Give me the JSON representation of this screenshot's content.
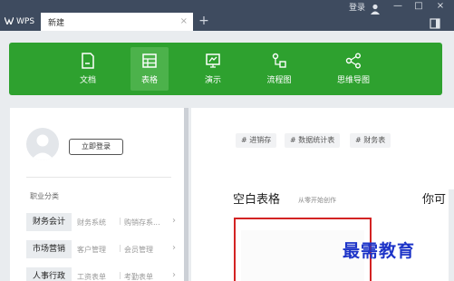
{
  "titlebar": {
    "logo_text": "WPS",
    "tab_label": "新建",
    "tab_close": "×",
    "new_tab": "+",
    "login_text": "登录",
    "win_minimize": "—",
    "win_maximize": "□",
    "win_close": "×"
  },
  "toolbar": {
    "items": [
      {
        "label": "文档",
        "icon": "document-icon"
      },
      {
        "label": "表格",
        "icon": "table-icon"
      },
      {
        "label": "演示",
        "icon": "presentation-icon"
      },
      {
        "label": "流程图",
        "icon": "flowchart-icon"
      },
      {
        "label": "思维导图",
        "icon": "mindmap-icon"
      }
    ],
    "active_index": 1,
    "colors": {
      "bg": "#2ea12f",
      "active": "#4cb24b"
    }
  },
  "left": {
    "login_button": "立即登录",
    "category_title": "职业分类",
    "categories": [
      {
        "main": "财务会计",
        "sub1": "财务系统",
        "sub2": "购销存系..."
      },
      {
        "main": "市场营销",
        "sub1": "客户管理",
        "sub2": "会员管理"
      },
      {
        "main": "人事行政",
        "sub1": "工资表单",
        "sub2": "考勤表单"
      }
    ]
  },
  "right": {
    "tags": [
      "# 进销存",
      "# 数据统计表",
      "# 财务表"
    ],
    "section_title": "空白表格",
    "section_sub": "从零开始创作",
    "section_title2": "你可"
  },
  "watermark": "最需教育"
}
